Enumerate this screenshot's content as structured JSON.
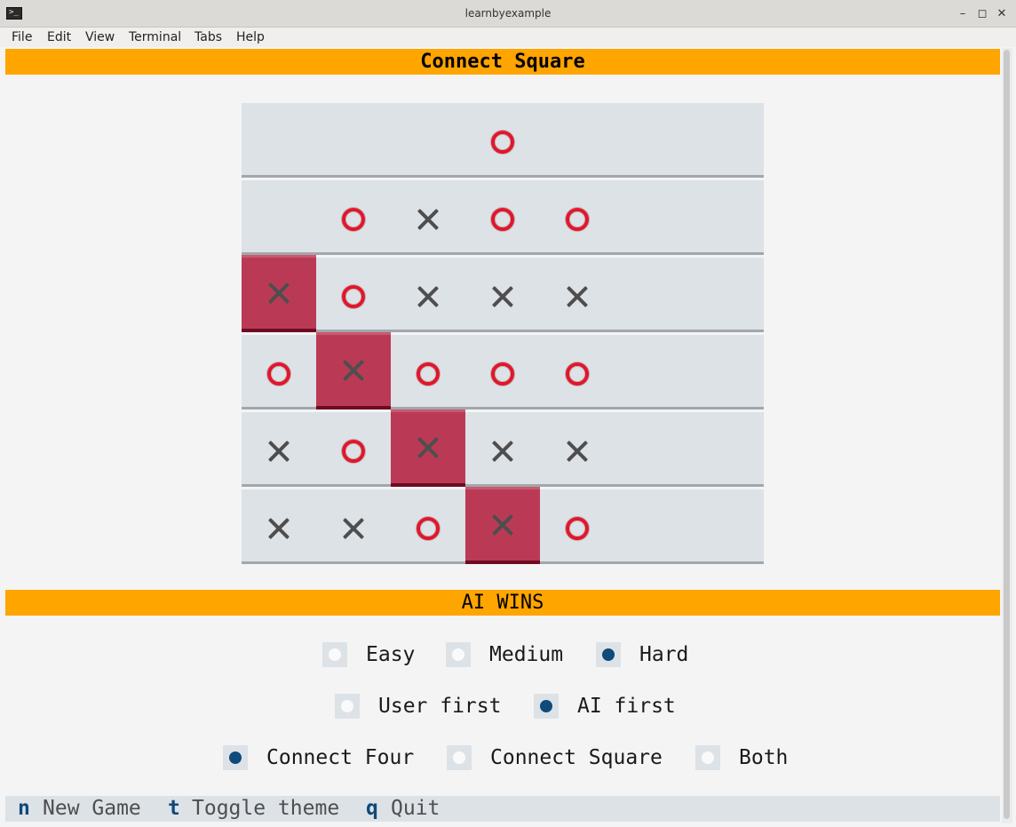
{
  "window": {
    "title": "learnbyexample",
    "menu": [
      "File",
      "Edit",
      "View",
      "Terminal",
      "Tabs",
      "Help"
    ]
  },
  "game": {
    "title": "Connect Square",
    "status": "AI WINS",
    "board": [
      [
        "",
        "",
        "",
        "O",
        "",
        "",
        ""
      ],
      [
        "",
        "O",
        "X",
        "O",
        "O",
        "",
        ""
      ],
      [
        "X",
        "O",
        "X",
        "X",
        "X",
        "",
        ""
      ],
      [
        "O",
        "X",
        "O",
        "O",
        "O",
        "",
        ""
      ],
      [
        "X",
        "O",
        "X",
        "X",
        "X",
        "",
        ""
      ],
      [
        "X",
        "X",
        "O",
        "X",
        "O",
        "",
        ""
      ]
    ],
    "winning_cells": [
      [
        2,
        0
      ],
      [
        3,
        1
      ],
      [
        4,
        2
      ],
      [
        5,
        3
      ]
    ],
    "colors": {
      "banner": "#ffa500",
      "win_cell": "#ba3a55",
      "o_mark": "#e0172b",
      "x_mark": "#4e4e4e",
      "selected_radio": "#0e4a7a"
    }
  },
  "options": {
    "difficulty": [
      {
        "label": "Easy",
        "selected": false
      },
      {
        "label": "Medium",
        "selected": false
      },
      {
        "label": "Hard",
        "selected": true
      }
    ],
    "first_player": [
      {
        "label": "User first",
        "selected": false
      },
      {
        "label": "AI first",
        "selected": true
      }
    ],
    "mode": [
      {
        "label": "Connect Four",
        "selected": true
      },
      {
        "label": "Connect Square",
        "selected": false
      },
      {
        "label": "Both",
        "selected": false
      }
    ]
  },
  "footer": {
    "bindings": [
      {
        "key": "n",
        "label": "New Game"
      },
      {
        "key": "t",
        "label": "Toggle theme"
      },
      {
        "key": "q",
        "label": "Quit"
      }
    ]
  }
}
